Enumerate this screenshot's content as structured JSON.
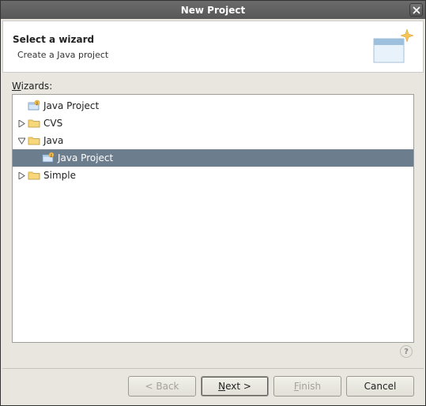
{
  "window": {
    "title": "New Project"
  },
  "header": {
    "title": "Select a wizard",
    "description": "Create a Java project"
  },
  "wizards_label_pre": "W",
  "wizards_label_post": "izards:",
  "tree": {
    "items": [
      {
        "label": "Java Project",
        "icon": "java-project-icon",
        "depth": 0,
        "expander": "none",
        "selected": false
      },
      {
        "label": "CVS",
        "icon": "folder-icon",
        "depth": 0,
        "expander": "closed",
        "selected": false
      },
      {
        "label": "Java",
        "icon": "folder-icon",
        "depth": 0,
        "expander": "open",
        "selected": false
      },
      {
        "label": "Java Project",
        "icon": "java-project-icon",
        "depth": 1,
        "expander": "none",
        "selected": true
      },
      {
        "label": "Simple",
        "icon": "folder-icon",
        "depth": 0,
        "expander": "closed",
        "selected": false
      }
    ]
  },
  "buttons": {
    "back": "< Back",
    "next_pre": "N",
    "next_post": "ext >",
    "finish_pre": "F",
    "finish_post": "inish",
    "cancel": "Cancel"
  }
}
